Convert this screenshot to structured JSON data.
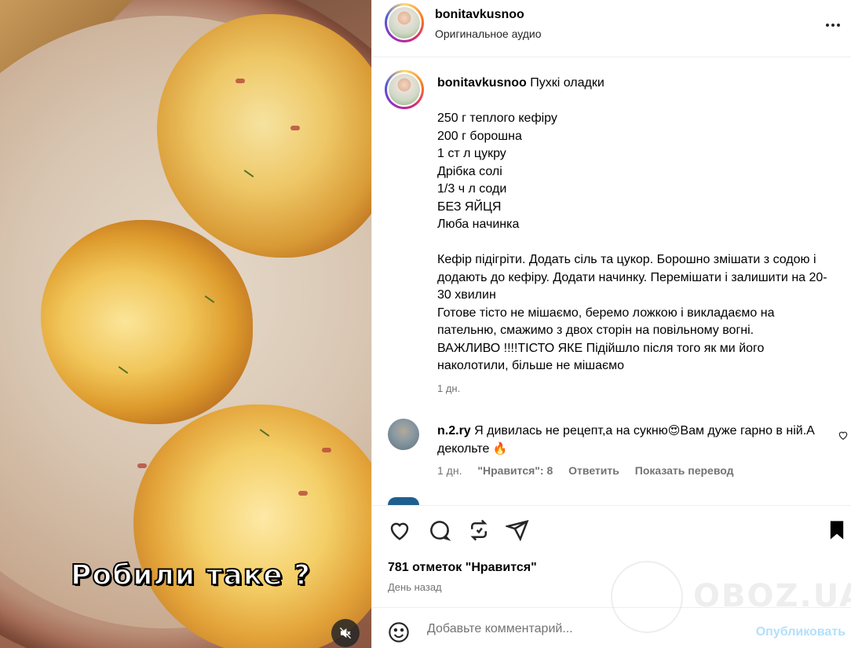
{
  "post": {
    "username": "bonitavkusnoo",
    "audio": "Оригинальное аудио",
    "video_caption": "Робили таке ?",
    "caption_title": "Пухкі оладки",
    "caption_body": "\n\n250 г теплого кефіру\n200 г борошна\n1 ст л цукру\nДрібка солі\n1/3 ч л соди\nБЕЗ ЯЙЦЯ\nЛюба начинка\n\nКефір підігріти. Додать сіль та цукор. Борошно змішати з содою і додають до кефіру. Додати начинку. Перемішати і залишити на 20-30 хвилин\nГотове тісто не мішаємо, беремо ложкою і викладаємо на пательню, смажимо з двох сторін на повільному вогні.\nВАЖЛИВО !!!!ТІСТО ЯКЕ Підійшло після того як ми його наколотили, більше не мішаємо",
    "caption_time": "1 дн."
  },
  "comment": {
    "username": "n.2.ry",
    "text_part1": "Я дивилась не рецепт,а на сукню",
    "emoji1": "😍",
    "text_part2": "Вам дуже гарно в ній.А декольте ",
    "emoji2": "🔥",
    "time": "1 дн.",
    "likes": "\"Нравится\": 8",
    "reply": "Ответить",
    "translate": "Показать перевод"
  },
  "actions": {
    "likes": "781 отметок \"Нравится\"",
    "time_ago": "День назад"
  },
  "add_comment": {
    "placeholder": "Добавьте комментарий...",
    "publish": "Опубликовать"
  },
  "watermark": {
    "text": "OBOZ.UA"
  },
  "icons": {
    "more": "more-horizontal-icon",
    "like": "heart-icon",
    "comment": "comment-icon",
    "share": "repost-icon",
    "send": "send-icon",
    "save": "bookmark-icon",
    "emoji": "smiley-icon",
    "mute": "speaker-muted-icon"
  },
  "colors": {
    "publish": "#b2dffc",
    "text": "#262626",
    "muted": "#737373"
  }
}
